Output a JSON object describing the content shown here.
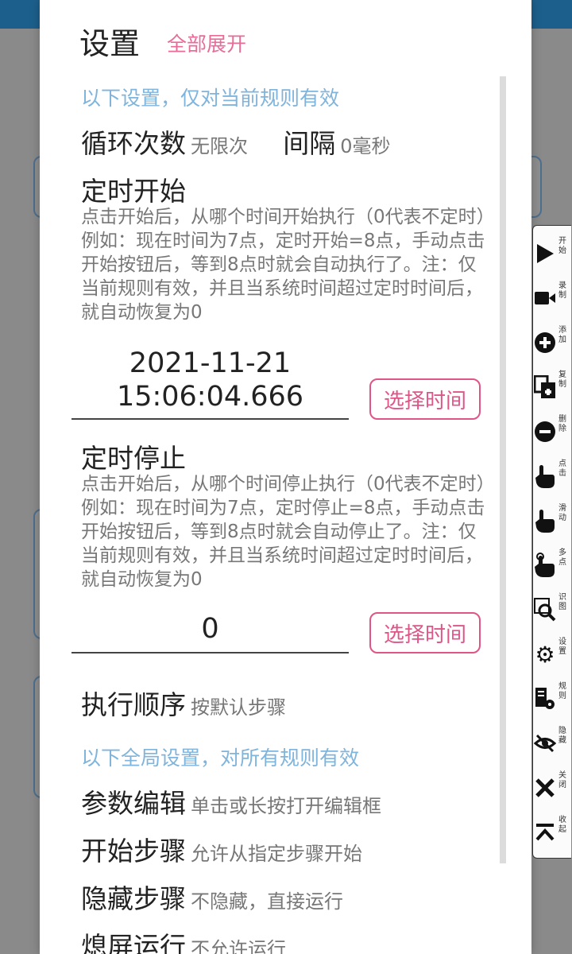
{
  "dialog": {
    "title": "设置",
    "expand_all": "全部展开",
    "note_current": "以下设置，仅对当前规则有效",
    "loop": {
      "label": "循环次数",
      "value": "无限次"
    },
    "interval": {
      "label": "间隔",
      "value": "0毫秒"
    },
    "start": {
      "heading": "定时开始",
      "desc": "点击开始后，从哪个时间开始执行（0代表不定时）例如：现在时间为7点，定时开始=8点，手动点击开始按钮后，等到8点时就会自动执行了。注：仅当前规则有效，并且当系统时间超过定时时间后，就自动恢复为0",
      "date": "2021-11-21",
      "time": "15:06:04.666",
      "button": "选择时间"
    },
    "stop": {
      "heading": "定时停止",
      "desc": "点击开始后，从哪个时间停止执行（0代表不定时）例如：现在时间为7点，定时停止=8点，手动点击开始按钮后，等到8点时就会自动停止了。注：仅当前规则有效，并且当系统时间超过定时时间后，就自动恢复为0",
      "value": "0",
      "button": "选择时间"
    },
    "order": {
      "label": "执行顺序",
      "value": "按默认步骤"
    },
    "note_global": "以下全局设置，对所有规则有效",
    "param": {
      "label": "参数编辑",
      "value": "单击或长按打开编辑框"
    },
    "start_step": {
      "label": "开始步骤",
      "value": "允许从指定步骤开始"
    },
    "hide_step": {
      "label": "隐藏步骤",
      "value": "不隐藏，直接运行"
    },
    "screen_off": {
      "label": "熄屏运行",
      "value": "不允许运行"
    }
  },
  "toolbar": [
    {
      "label": "开始",
      "icon": "play-icon"
    },
    {
      "label": "录制",
      "icon": "video-icon"
    },
    {
      "label": "添加",
      "icon": "plus-circle-icon"
    },
    {
      "label": "复制",
      "icon": "copy-icon"
    },
    {
      "label": "删除",
      "icon": "minus-circle-icon"
    },
    {
      "label": "点击",
      "icon": "tap-icon"
    },
    {
      "label": "滑动",
      "icon": "swipe-icon"
    },
    {
      "label": "多点",
      "icon": "multi-tap-icon"
    },
    {
      "label": "识图",
      "icon": "image-search-icon"
    },
    {
      "label": "设置",
      "icon": "gear-icon"
    },
    {
      "label": "规则",
      "icon": "rules-icon"
    },
    {
      "label": "隐藏",
      "icon": "eye-off-icon"
    },
    {
      "label": "关闭",
      "icon": "close-icon"
    },
    {
      "label": "收起",
      "icon": "collapse-icon"
    }
  ],
  "colors": {
    "accent_pink": "#e05588",
    "note_blue": "#7fb4dc"
  }
}
